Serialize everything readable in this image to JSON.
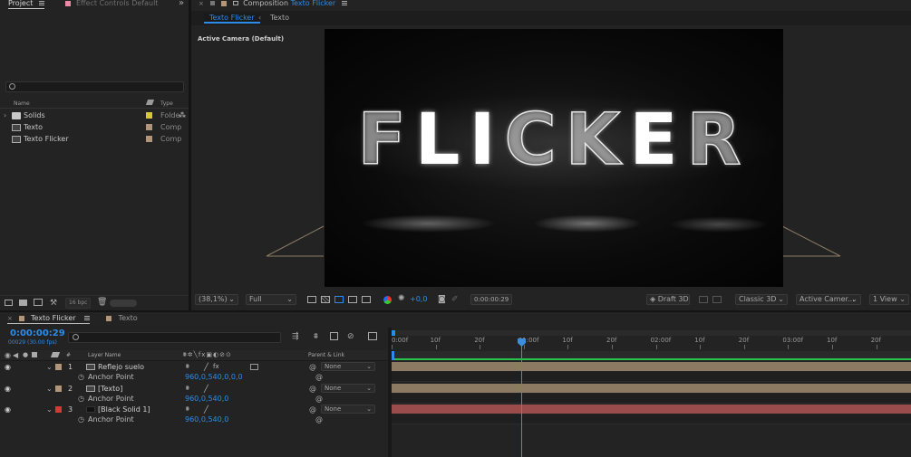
{
  "project_panel": {
    "tab_project": "Project",
    "tab_effect_controls": "Effect Controls Default",
    "overflow": "»",
    "columns": {
      "name": "Name",
      "type": "Type"
    },
    "items": [
      {
        "name": "Solids",
        "type": "Folde",
        "swatch": "#d8c53a",
        "icon": "folder-icon"
      },
      {
        "name": "Texto",
        "type": "Comp",
        "swatch": "#b3957a",
        "icon": "composition-icon"
      },
      {
        "name": "Texto Flicker",
        "type": "Comp",
        "swatch": "#b3957a",
        "icon": "composition-icon"
      }
    ],
    "bpc": "16 bpc"
  },
  "composition_panel": {
    "title_prefix": "Composition",
    "title_name": "Texto Flicker",
    "breadcrumb": [
      "Texto Flicker",
      "Texto"
    ],
    "camera_label": "Active Camera (Default)",
    "viewer_text": "FLICKER",
    "zoom": "(38,1%)",
    "resolution": "Full",
    "exposure": "+0,0",
    "timecode": "0:00:00:29",
    "draft": "Draft 3D",
    "renderer": "Classic 3D",
    "camera_select": "Active Camer...",
    "views": "1 View"
  },
  "timeline_panel": {
    "tab_active": "Texto Flicker",
    "tab_other": "Texto",
    "timecode": "0:00:00:29",
    "timecode_sub": "00029 (30.00 fps)",
    "headers": {
      "num": "#",
      "layer_name": "Layer Name",
      "parent": "Parent & Link"
    },
    "ruler_ticks": [
      "0:00f",
      "10f",
      "20f",
      "01:00f",
      "10f",
      "20f",
      "02:00f",
      "10f",
      "20f",
      "03:00f",
      "10f",
      "20f"
    ],
    "layers": [
      {
        "num": "1",
        "name": "Reflejo suelo",
        "label_color": "#b3957a",
        "parent": "None",
        "prop": "Anchor Point",
        "prop_value": "960,0,540,0,0,0",
        "bar_color": "#8c7a62"
      },
      {
        "num": "2",
        "name": "[Texto]",
        "label_color": "#b3957a",
        "parent": "None",
        "prop": "Anchor Point",
        "prop_value": "960,0,540,0",
        "bar_color": "#8c7a62"
      },
      {
        "num": "3",
        "name": "[Black Solid 1]",
        "label_color": "#d23a3a",
        "parent": "None",
        "prop": "Anchor Point",
        "prop_value": "960,0,540,0",
        "bar_color": "#9a4b4b"
      }
    ]
  },
  "colors": {
    "accent": "#2d8ceb",
    "playhead": "#3b8edb",
    "work_area": "#26c44a"
  }
}
